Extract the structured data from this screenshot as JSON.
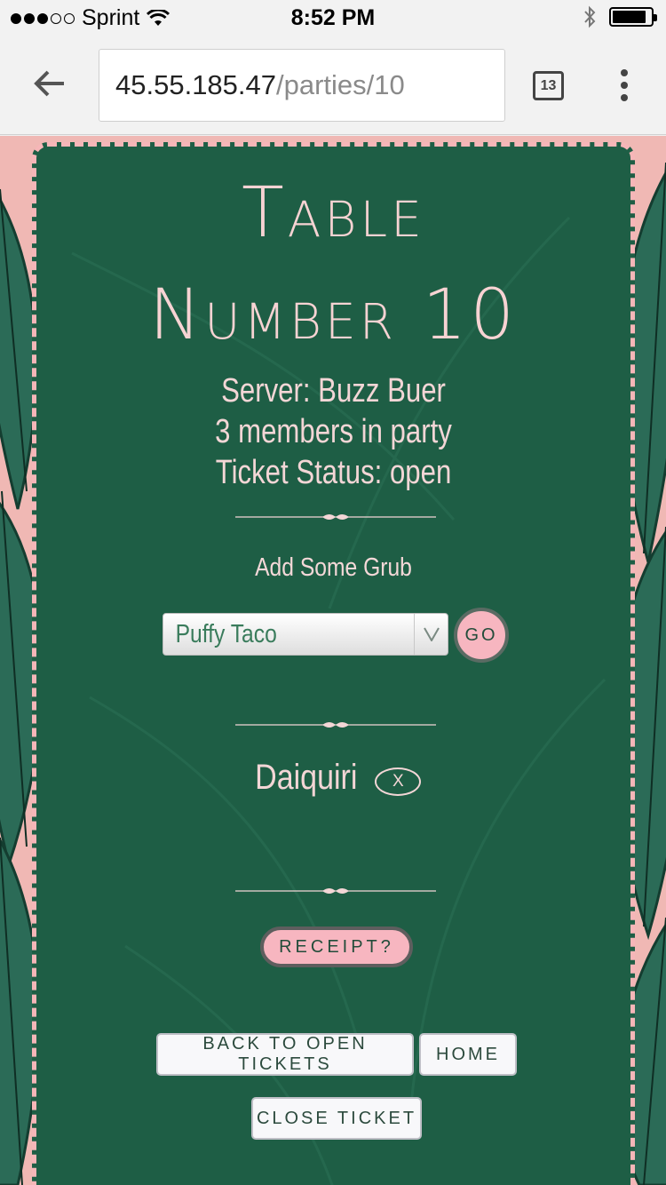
{
  "status_bar": {
    "carrier": "Sprint",
    "time": "8:52 PM",
    "signal_bars_filled": 3,
    "signal_bars_total": 5,
    "battery_level": 0.9
  },
  "browser": {
    "url_host": "45.55.185.47",
    "url_path": "/parties/10",
    "tab_count": "13"
  },
  "page": {
    "title_line1": "Table",
    "title_line2": "Number 10",
    "server": "Server: Buzz Buer",
    "members": "3 members in party",
    "ticket_status": "Ticket Status: open",
    "add_label": "Add Some Grub",
    "menu_select_value": "Puffy Taco",
    "go_label": "GO",
    "order_items": [
      "Daiquiri"
    ],
    "remove_label": "X",
    "receipt_label": "RECEIPT?",
    "back_label": "BACK TO OPEN TICKETS",
    "home_label": "HOME",
    "close_label": "CLOSE TICKET"
  },
  "colors": {
    "card_green": "#1e5e45",
    "accent_pink": "#f7b6c0",
    "background_pink": "#f0b8b4"
  }
}
